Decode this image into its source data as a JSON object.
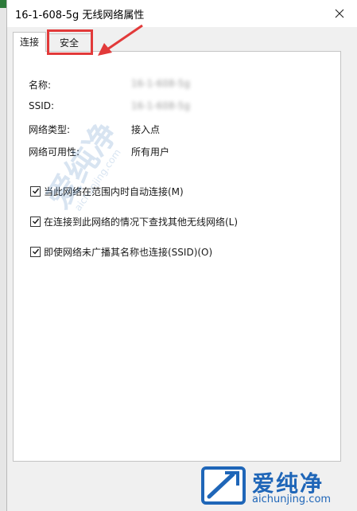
{
  "window": {
    "title": "16-1-608-5g 无线网络属性"
  },
  "tabs": [
    {
      "label": "连接",
      "selected": true
    },
    {
      "label": "安全",
      "selected": false
    }
  ],
  "fields": [
    {
      "label": "名称:",
      "value": "16-1-608-5g",
      "obscured": true
    },
    {
      "label": "SSID:",
      "value": "16-1-608-5g",
      "obscured": true
    },
    {
      "label": "网络类型:",
      "value": "接入点",
      "obscured": false
    },
    {
      "label": "网络可用性:",
      "value": "所有用户",
      "obscured": false
    }
  ],
  "checkboxes": [
    {
      "label": "当此网络在范围内时自动连接(M)",
      "checked": true
    },
    {
      "label": "在连接到此网络的情况下查找其他无线网络(L)",
      "checked": true
    },
    {
      "label": "即使网络未广播其名称也连接(SSID)(O)",
      "checked": true
    }
  ],
  "annotation": {
    "highlight_color": "#e23a3a",
    "target": "安全"
  },
  "watermark": {
    "chars": "爱纯净",
    "url": "aichunjing.com",
    "color": "#1f66b8"
  },
  "icons": {
    "close": "close-icon",
    "checkmark": "checkmark-icon",
    "arrow": "arrow-icon",
    "logo": "aichunjing-logo-icon"
  }
}
